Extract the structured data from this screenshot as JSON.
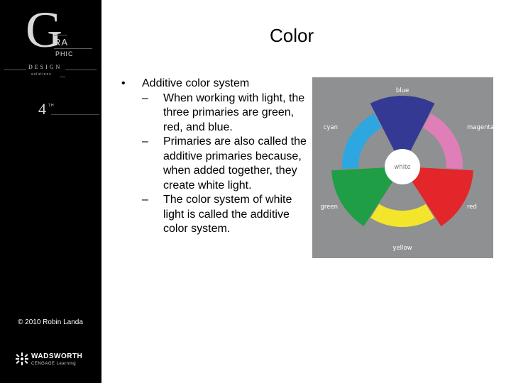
{
  "sidebar": {
    "logo": {
      "g": "G",
      "ra": "RA",
      "phic": "PHIC",
      "design": "DESIGN",
      "solutions": "solutions",
      "edition_number": "4",
      "edition_suffix": "TH"
    },
    "copyright": "© 2010 Robin Landa",
    "publisher": {
      "name": "WADSWORTH",
      "sub": "CENGAGE Learning"
    }
  },
  "slide": {
    "title": "Color",
    "bullet": "Additive color system",
    "subbullets": [
      "When working with light, the three primaries are green, red, and blue.",
      "Primaries are also called the additive primaries because, when added together, they create white light.",
      "The color system of white light is called the additive color system."
    ],
    "dash": "–",
    "bullet_mark": "•"
  },
  "color_wheel": {
    "background": "#8f9091",
    "center_label": "white",
    "segments": [
      {
        "name": "blue",
        "color": "#343a94",
        "kind": "primary"
      },
      {
        "name": "magenta",
        "color": "#e07eb8",
        "kind": "secondary"
      },
      {
        "name": "red",
        "color": "#e2262a",
        "kind": "primary"
      },
      {
        "name": "yellow",
        "color": "#f3e52c",
        "kind": "secondary"
      },
      {
        "name": "green",
        "color": "#1f9e45",
        "kind": "primary"
      },
      {
        "name": "cyan",
        "color": "#2ea7e0",
        "kind": "secondary"
      }
    ]
  }
}
